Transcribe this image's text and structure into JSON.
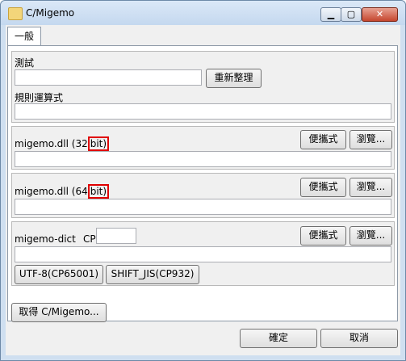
{
  "window": {
    "title": "C/Migemo"
  },
  "tabs": [
    {
      "label": "一般"
    }
  ],
  "test": {
    "label": "測試",
    "input_value": "",
    "rebuild_button": "重新整理"
  },
  "regex": {
    "label": "規則運算式",
    "value": ""
  },
  "dll32": {
    "label_prefix": "migemo.dll (32",
    "label_highlight": "bit)",
    "portable_button": "便攜式",
    "browse_button": "瀏覽...",
    "path_value": ""
  },
  "dll64": {
    "label_prefix": "migemo.dll (64",
    "label_highlight": "bit)",
    "portable_button": "便攜式",
    "browse_button": "瀏覽...",
    "path_value": ""
  },
  "dict": {
    "label": "migemo-dict",
    "cp_label": "CP",
    "cp_value": "",
    "portable_button": "便攜式",
    "browse_button": "瀏覽...",
    "path_value": "",
    "utf8_button": "UTF-8(CP65001)",
    "sjis_button": "SHIFT_JIS(CP932)"
  },
  "get_button": "取得 C/Migemo...",
  "footer": {
    "ok_button": "確定",
    "cancel_button": "取消"
  }
}
